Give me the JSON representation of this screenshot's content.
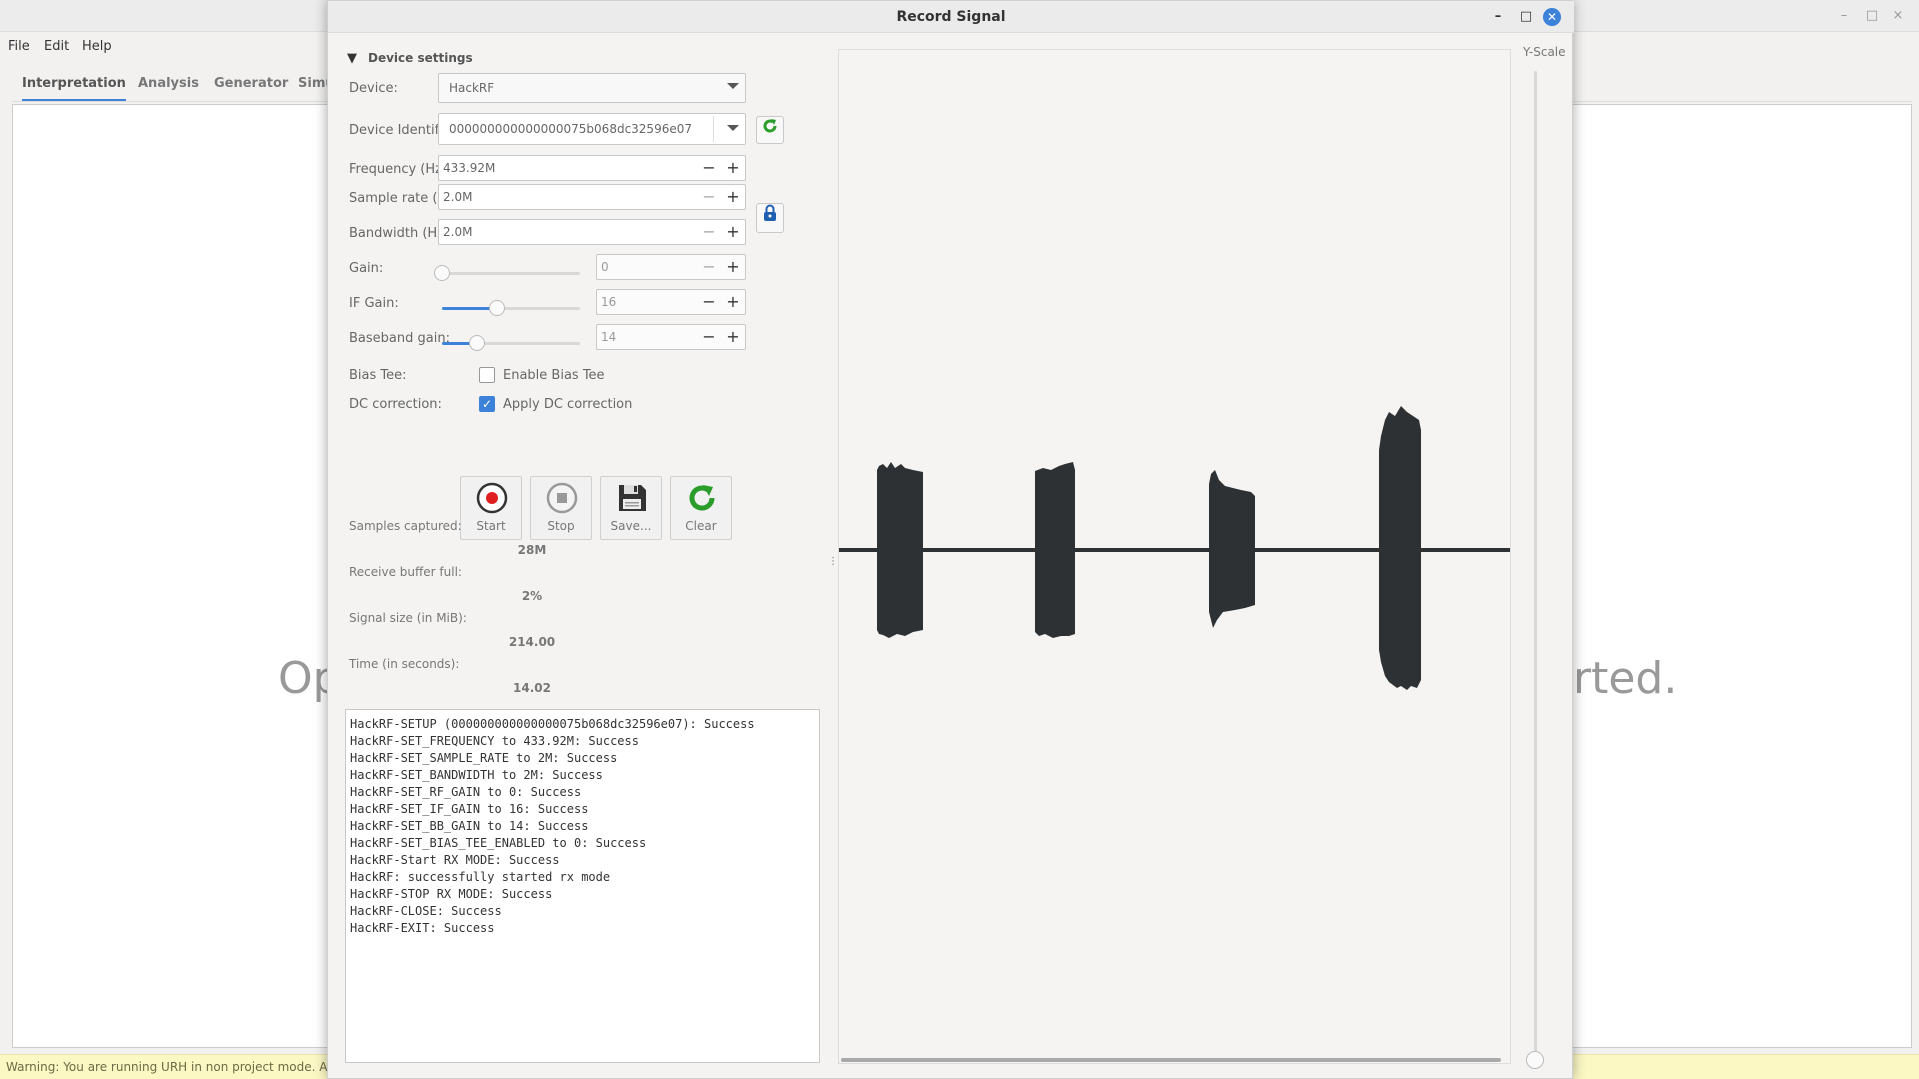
{
  "background_app": {
    "menu": [
      "File",
      "Edit",
      "Help"
    ],
    "tabs": [
      "Interpretation",
      "Analysis",
      "Generator",
      "Simu"
    ],
    "content_text_left": "Op",
    "content_text_right": "rted.",
    "status_text": "Warning: You are running URH in non project mode. All yo"
  },
  "dialog": {
    "title": "Record Signal",
    "section_title": "Device settings",
    "device": {
      "label": "Device:",
      "value": "HackRF"
    },
    "device_identifier": {
      "label": "Device Identifier:",
      "value": "000000000000000075b068dc32596e07"
    },
    "frequency": {
      "label": "Frequency (Hz):",
      "value": "433.92M"
    },
    "sample_rate": {
      "label": "Sample rate (Sps):",
      "value": "2.0M"
    },
    "bandwidth": {
      "label": "Bandwidth (Hz):",
      "value": "2.0M"
    },
    "gain": {
      "label": "Gain:",
      "value": "0",
      "level": 0.0
    },
    "if_gain": {
      "label": "IF Gain:",
      "value": "16",
      "level": 0.4
    },
    "baseband_gain": {
      "label": "Baseband gain:",
      "value": "14",
      "level": 0.25
    },
    "bias_tee": {
      "label": "Bias Tee:",
      "checkbox_label": "Enable Bias Tee",
      "checked": false
    },
    "dc_correction": {
      "label": "DC correction:",
      "checkbox_label": "Apply DC correction",
      "checked": true
    },
    "buttons": {
      "start": "Start",
      "stop": "Stop",
      "save": "Save...",
      "clear": "Clear"
    },
    "stats": {
      "samples_captured_label": "Samples captured:",
      "samples_captured": "28M",
      "receive_buffer_label": "Receive buffer full:",
      "receive_buffer": "2%",
      "signal_size_label": "Signal size (in MiB):",
      "signal_size": "214.00",
      "time_label": "Time (in seconds):",
      "time": "14.02"
    },
    "log": [
      "HackRF-SETUP (000000000000000075b068dc32596e07): Success",
      "HackRF-SET_FREQUENCY to 433.92M: Success",
      "HackRF-SET_SAMPLE_RATE to 2M: Success",
      "HackRF-SET_BANDWIDTH to 2M: Success",
      "HackRF-SET_RF_GAIN to 0: Success",
      "HackRF-SET_IF_GAIN to 16: Success",
      "HackRF-SET_BB_GAIN to 14: Success",
      "HackRF-SET_BIAS_TEE_ENABLED to 0: Success",
      "HackRF-Start RX MODE: Success",
      "HackRF: successfully started rx mode",
      "HackRF-STOP RX MODE: Success",
      "HackRF-CLOSE: Success",
      "HackRF-EXIT: Success"
    ],
    "y_scale_label": "Y-Scale"
  },
  "colors": {
    "accent": "#3c82d8",
    "signal": "#2e3134",
    "record_red": "#e02020",
    "refresh_green": "#2a9d2a"
  }
}
